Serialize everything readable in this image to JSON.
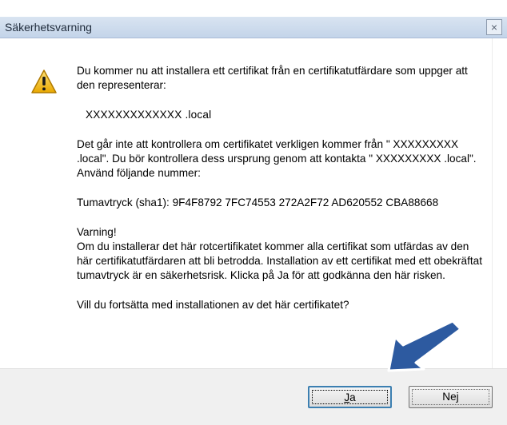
{
  "window": {
    "title": "Säkerhetsvarning",
    "close_glyph": "×"
  },
  "message": {
    "p1": "Du kommer nu att installera ett certifikat från en certifikatutfärdare som uppger att den representerar:",
    "host": "XXXXXXXXXXXXX .local",
    "p3": "Det går inte att kontrollera om certifikatet verkligen kommer från \" XXXXXXXXX .local\". Du bör kontrollera dess ursprung genom att kontakta \" XXXXXXXXX .local\". Använd följande nummer:",
    "thumbprint": "Tumavtryck (sha1): 9F4F8792 7FC74553 272A2F72 AD620552 CBA88668",
    "warning_heading": "Varning!",
    "warning_body": "Om du installerar det här rotcertifikatet kommer alla certifikat som utfärdas av den här certifikatutfärdaren att bli betrodda. Installation av ett certifikat med ett obekräftat tumavtryck är en säkerhetsrisk. Klicka på Ja för att godkänna den här risken.",
    "question": "Vill du fortsätta med installationen av det här certifikatet?"
  },
  "buttons": {
    "yes_accel": "J",
    "yes_rest": "a",
    "no_pre": "Ne",
    "no_accel": "j"
  },
  "icons": {
    "warning": "warning-triangle-icon",
    "arrow": "pointer-arrow-icon"
  },
  "colors": {
    "arrow": "#2d5aa0",
    "warning_fill": "#f5c518"
  }
}
